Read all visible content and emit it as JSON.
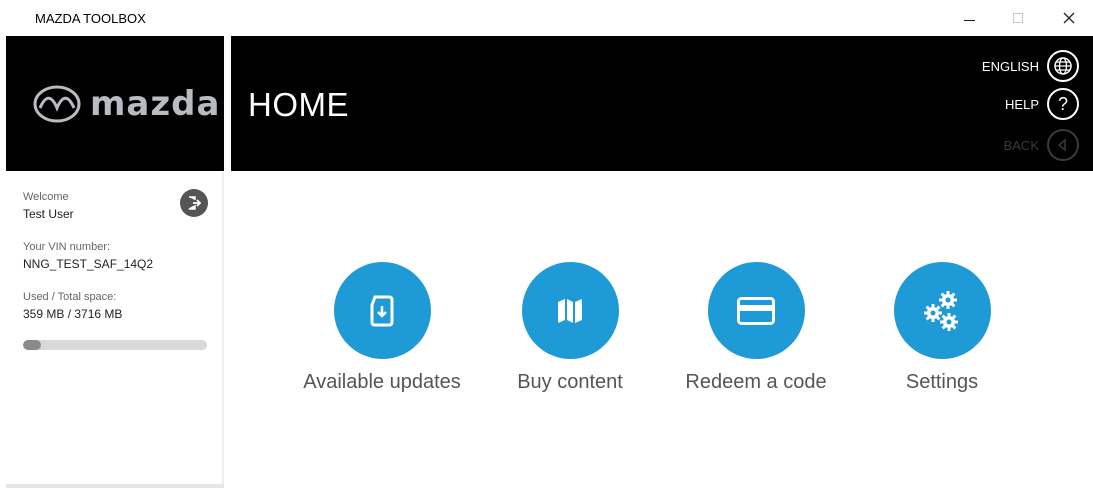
{
  "window": {
    "title": "MAZDA TOOLBOX"
  },
  "brand": {
    "logo_text": "mazda"
  },
  "header": {
    "page_title": "HOME",
    "language_label": "ENGLISH",
    "help_label": "HELP",
    "back_label": "BACK"
  },
  "sidebar": {
    "welcome_label": "Welcome",
    "user_name": "Test User",
    "vin_label": "Your VIN number:",
    "vin_value": "NNG_TEST_SAF_14Q2",
    "space_label": "Used / Total space:",
    "space_value": "359 MB / 3716 MB",
    "space_used_fraction": 0.097
  },
  "tiles": [
    {
      "label": "Available updates",
      "icon": "download-file-icon"
    },
    {
      "label": "Buy content",
      "icon": "map-icon"
    },
    {
      "label": "Redeem a code",
      "icon": "card-icon"
    },
    {
      "label": "Settings",
      "icon": "gears-icon"
    }
  ],
  "colors": {
    "accent": "#1e9ad6",
    "header_bg": "#000000"
  }
}
